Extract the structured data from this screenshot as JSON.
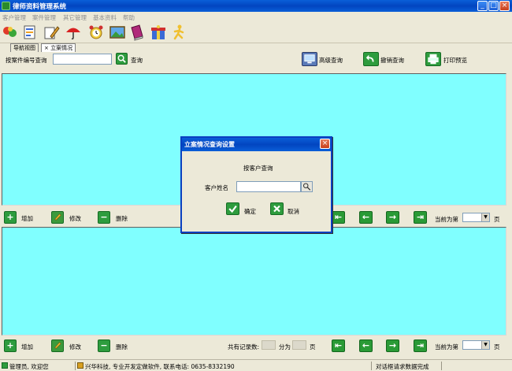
{
  "window": {
    "title": "律师资料管理系统"
  },
  "menu": [
    "客户管理",
    "案件管理",
    "其它管理",
    "基本资料",
    "帮助"
  ],
  "tabs": {
    "nav": "导航视图",
    "close_glyph": "×",
    "active": "立案情况"
  },
  "search": {
    "label": "按案件编号查询",
    "value": "",
    "button": "查询",
    "advanced": "高级查询",
    "cancel": "撤销查询",
    "print": "打印预览"
  },
  "mid_bar": {
    "add": "增加",
    "edit": "修改",
    "delete": "删除",
    "page_label": "当前为第",
    "page_unit": "页"
  },
  "bottom_bar": {
    "add": "增加",
    "edit": "修改",
    "delete": "删除",
    "total_label": "共有记录数:",
    "split_label": "分为",
    "page_unit_count": "页",
    "page_label": "当前为第",
    "page_unit": "页"
  },
  "dialog": {
    "title": "立案情况查询设置",
    "heading": "按客户查询",
    "field_label": "客户姓名",
    "field_value": "",
    "ok": "确定",
    "cancel": "取消"
  },
  "statusbar": {
    "user": "管理员, 欢迎您",
    "company": "兴华科技, 专业开发定做软件, 联系电话: 0635-8332190",
    "status": "对话框请求数据完成"
  },
  "colors": {
    "panel": "#80FFFF",
    "titlebar": "#0A5FD8",
    "accent": "#2e9c3e"
  }
}
